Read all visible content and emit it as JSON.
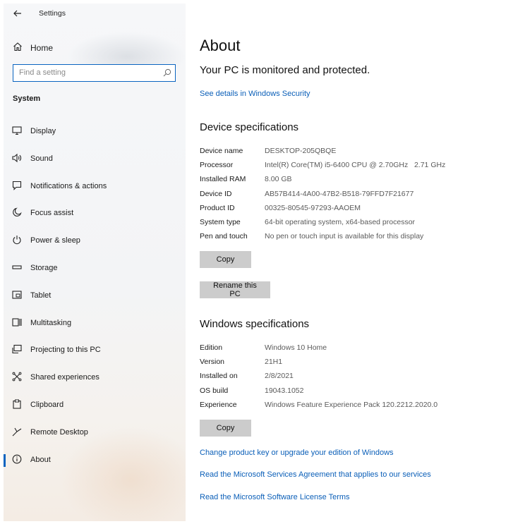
{
  "window": {
    "title": "Settings"
  },
  "sidebar": {
    "home_label": "Home",
    "search_placeholder": "Find a setting",
    "section_label": "System",
    "items": [
      {
        "label": "Display",
        "icon": "monitor-icon"
      },
      {
        "label": "Sound",
        "icon": "speaker-icon"
      },
      {
        "label": "Notifications & actions",
        "icon": "notification-icon"
      },
      {
        "label": "Focus assist",
        "icon": "moon-icon"
      },
      {
        "label": "Power & sleep",
        "icon": "power-icon"
      },
      {
        "label": "Storage",
        "icon": "storage-icon"
      },
      {
        "label": "Tablet",
        "icon": "tablet-icon"
      },
      {
        "label": "Multitasking",
        "icon": "multitasking-icon"
      },
      {
        "label": "Projecting to this PC",
        "icon": "projecting-icon"
      },
      {
        "label": "Shared experiences",
        "icon": "shared-icon"
      },
      {
        "label": "Clipboard",
        "icon": "clipboard-icon"
      },
      {
        "label": "Remote Desktop",
        "icon": "remote-desktop-icon"
      },
      {
        "label": "About",
        "icon": "info-icon",
        "active": true
      }
    ]
  },
  "main": {
    "title": "About",
    "protection_status": "Your PC is monitored and protected.",
    "security_link": "See details in Windows Security",
    "device_specs": {
      "heading": "Device specifications",
      "rows": [
        {
          "key": "Device name",
          "value": "DESKTOP-205QBQE"
        },
        {
          "key": "Processor",
          "value": "Intel(R) Core(TM) i5-6400 CPU @ 2.70GHz   2.71 GHz"
        },
        {
          "key": "Installed RAM",
          "value": "8.00 GB"
        },
        {
          "key": "Device ID",
          "value": "AB57B414-4A00-47B2-B518-79FFD7F21677"
        },
        {
          "key": "Product ID",
          "value": "00325-80545-97293-AAOEM"
        },
        {
          "key": "System type",
          "value": "64-bit operating system, x64-based processor"
        },
        {
          "key": "Pen and touch",
          "value": "No pen or touch input is available for this display"
        }
      ],
      "copy_label": "Copy",
      "rename_label": "Rename this PC"
    },
    "windows_specs": {
      "heading": "Windows specifications",
      "rows": [
        {
          "key": "Edition",
          "value": "Windows 10 Home"
        },
        {
          "key": "Version",
          "value": "21H1"
        },
        {
          "key": "Installed on",
          "value": "2/8/2021"
        },
        {
          "key": "OS build",
          "value": "19043.1052"
        },
        {
          "key": "Experience",
          "value": "Windows Feature Experience Pack 120.2212.2020.0"
        }
      ],
      "copy_label": "Copy"
    },
    "links": [
      "Change product key or upgrade your edition of Windows",
      "Read the Microsoft Services Agreement that applies to our services",
      "Read the Microsoft Software License Terms"
    ]
  },
  "colors": {
    "accent": "#0a64c0",
    "link": "#0b5fb8",
    "button": "#cccccc"
  }
}
